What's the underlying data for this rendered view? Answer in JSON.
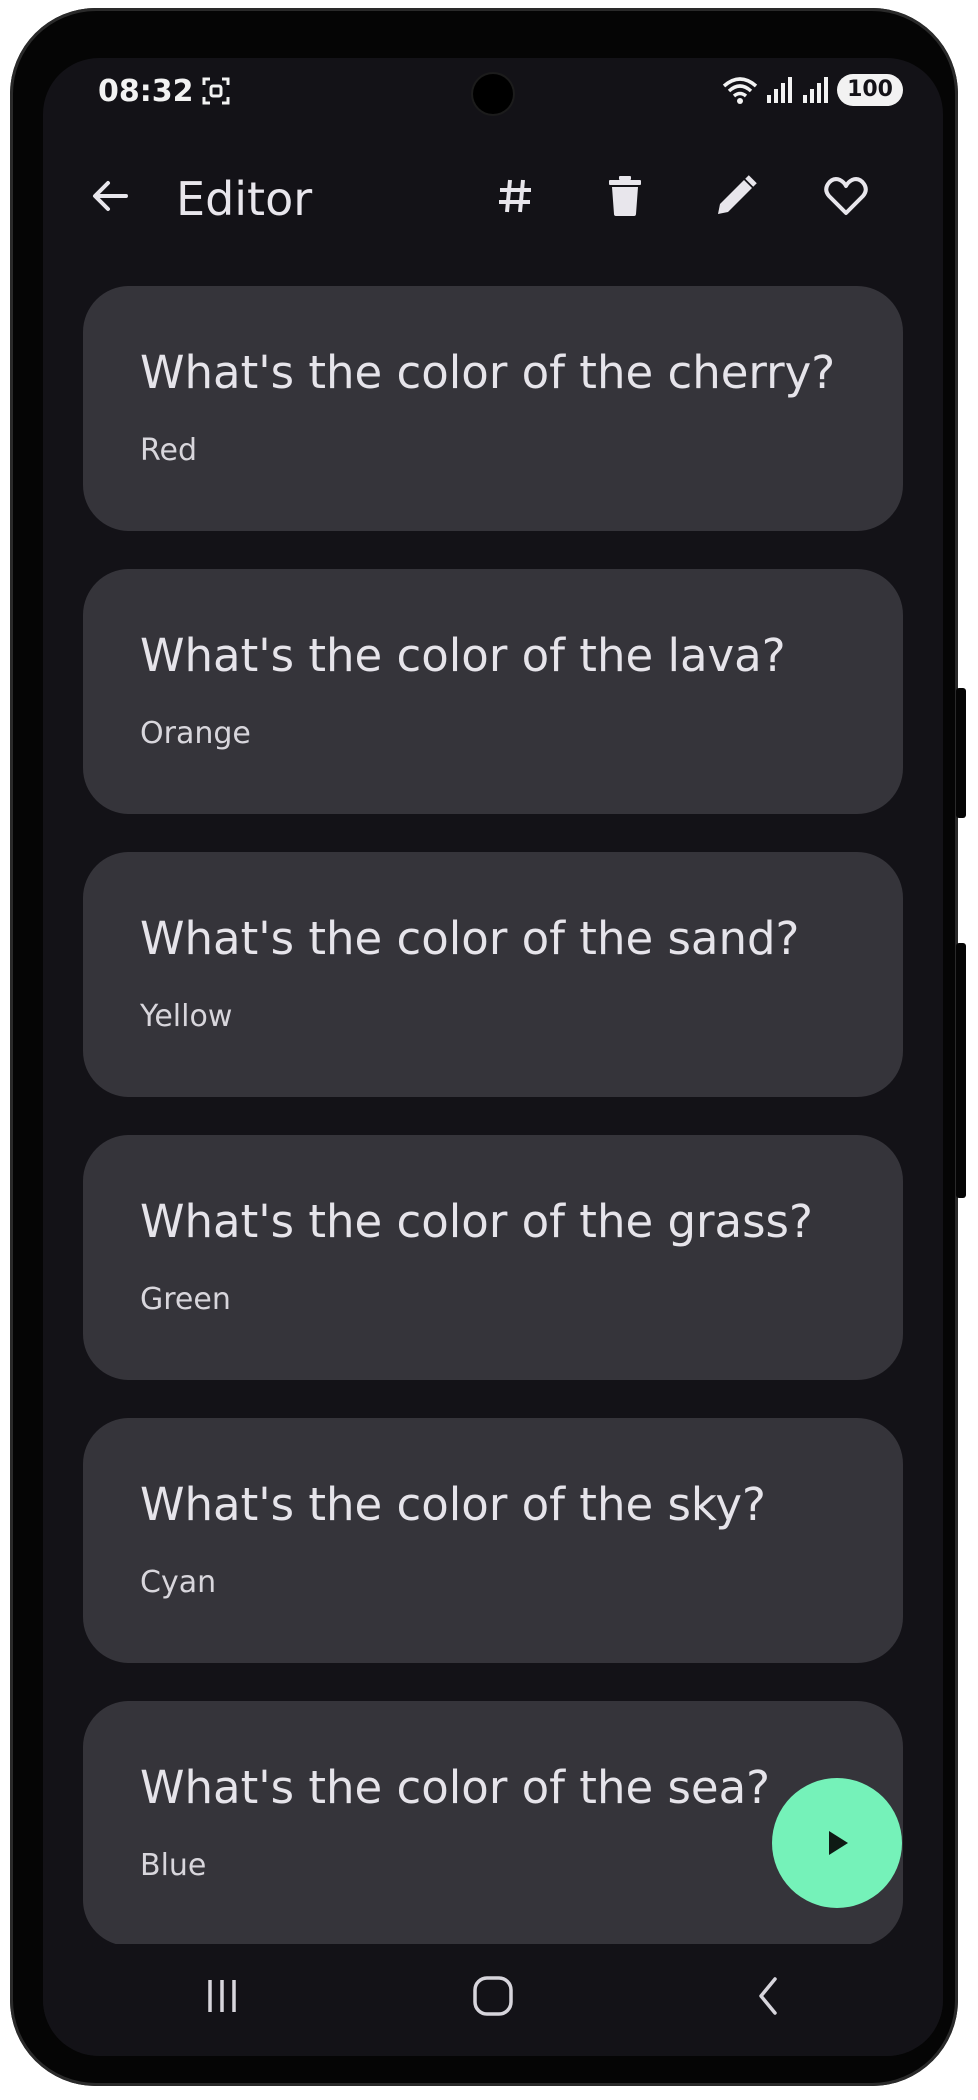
{
  "status_bar": {
    "time": "08:32",
    "battery": "100"
  },
  "app_bar": {
    "title": "Editor",
    "icons": [
      "back-arrow-icon",
      "hash-icon",
      "trash-icon",
      "pencil-icon",
      "heart-outline-icon"
    ]
  },
  "cards": [
    {
      "question": "What's the color of the cherry?",
      "answer": "Red"
    },
    {
      "question": "What's the color of the lava?",
      "answer": "Orange"
    },
    {
      "question": "What's the color of the sand?",
      "answer": "Yellow"
    },
    {
      "question": "What's the color of the grass?",
      "answer": "Green"
    },
    {
      "question": "What's the color of the sky?",
      "answer": "Cyan"
    },
    {
      "question": "What's the color of the sea?",
      "answer": "Blue"
    }
  ],
  "fab": {
    "icon": "play-icon",
    "color": "#75f2b9"
  },
  "nav_bar": {
    "icons": [
      "recents-icon",
      "home-icon",
      "back-icon"
    ]
  },
  "colors": {
    "background": "#131217",
    "card": "#35343a",
    "text": "#e6e4ea",
    "accent": "#75f2b9"
  }
}
